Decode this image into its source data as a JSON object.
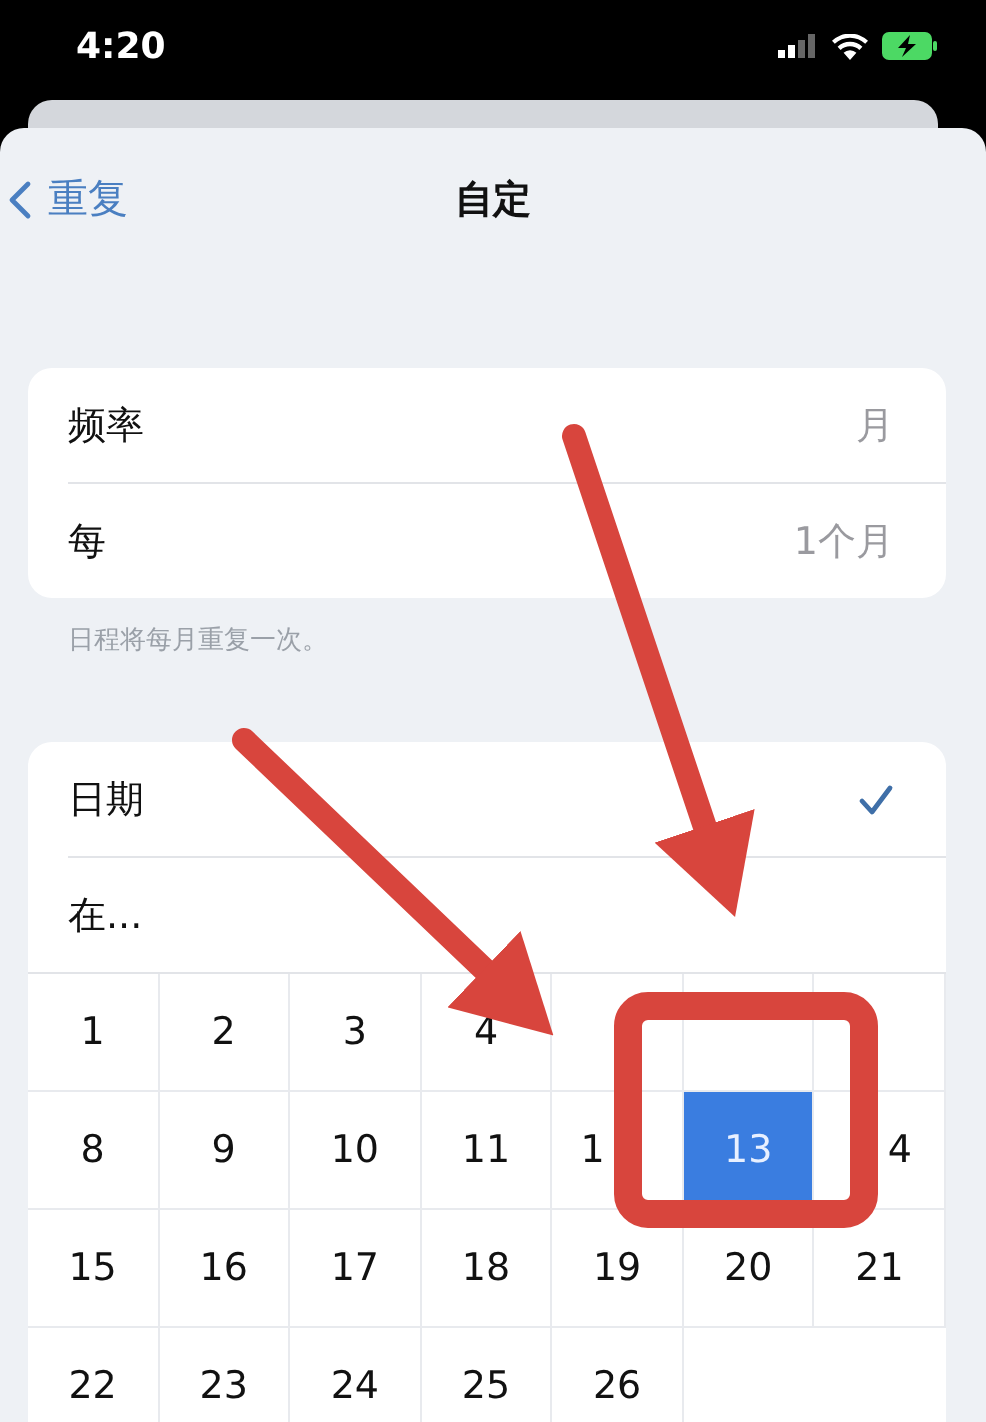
{
  "status_bar": {
    "time": "4:20"
  },
  "nav": {
    "back": "重复",
    "title": "自定"
  },
  "repeat_rows": [
    {
      "label": "频率",
      "value": "月"
    },
    {
      "label": "每",
      "value": "1个月"
    }
  ],
  "footer": "日程将每月重复一次。",
  "mode_options": [
    {
      "label": "日期",
      "selected": true
    },
    {
      "label": "在...",
      "selected": false
    }
  ],
  "days": [
    {
      "label": "1",
      "selected": false
    },
    {
      "label": "2",
      "selected": false
    },
    {
      "label": "3",
      "selected": false
    },
    {
      "label": "4",
      "selected": false
    },
    {
      "selected": false
    },
    {
      "selected": false
    },
    {
      "selected": false
    },
    {
      "label": "8",
      "selected": false
    },
    {
      "label": "9",
      "selected": false
    },
    {
      "label": "10",
      "selected": false
    },
    {
      "label": "11",
      "selected": false
    },
    {
      "label": "1",
      "selected": false
    },
    {
      "label": "13",
      "selected": true
    },
    {
      "label": "4",
      "selected": false
    },
    {
      "label": "15",
      "selected": false
    },
    {
      "label": "16",
      "selected": false
    },
    {
      "label": "17",
      "selected": false
    },
    {
      "label": "18",
      "selected": false
    },
    {
      "label": "19",
      "selected": false
    },
    {
      "label": "20",
      "selected": false
    },
    {
      "label": "21",
      "selected": false
    },
    {
      "label": "22",
      "selected": false
    },
    {
      "label": "23",
      "selected": false
    },
    {
      "label": "24",
      "selected": false
    },
    {
      "label": "25",
      "selected": false
    },
    {
      "label": "26",
      "selected": false
    }
  ]
}
